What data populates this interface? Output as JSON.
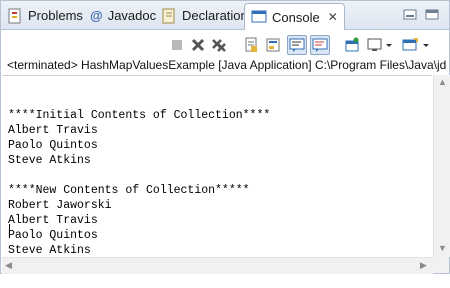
{
  "tabs": [
    {
      "label": "Problems",
      "icon": "problems-icon"
    },
    {
      "label": "Javadoc",
      "icon": "javadoc-at-icon"
    },
    {
      "label": "Declaration",
      "icon": "declaration-icon"
    },
    {
      "label": "Console",
      "icon": "console-icon",
      "active": true
    }
  ],
  "javadoc_symbol": "@",
  "close_symbol": "✕",
  "status_line": "<terminated> HashMapValuesExample [Java Application] C:\\Program Files\\Java\\jdk",
  "console_lines": [
    "****Initial Contents of Collection****",
    "Albert Travis",
    "Paolo Quintos",
    "Steve Atkins",
    "",
    "****New Contents of Collection*****",
    "Robert Jaworski",
    "Albert Travis",
    "Paolo Quintos",
    "Steve Atkins"
  ],
  "toolbar_icons": [
    "terminate-icon",
    "remove-launch-icon",
    "remove-all-terminated-icon",
    "scroll-lock-icon",
    "word-wrap-icon",
    "show-on-stdout-icon",
    "show-on-stderr-icon",
    "pin-console-icon",
    "display-console-icon",
    "open-console-icon"
  ],
  "colors": {
    "accent": "#2f6fb8",
    "terminate_red": "#c0392b",
    "tab_bg": "#dde5f0"
  }
}
